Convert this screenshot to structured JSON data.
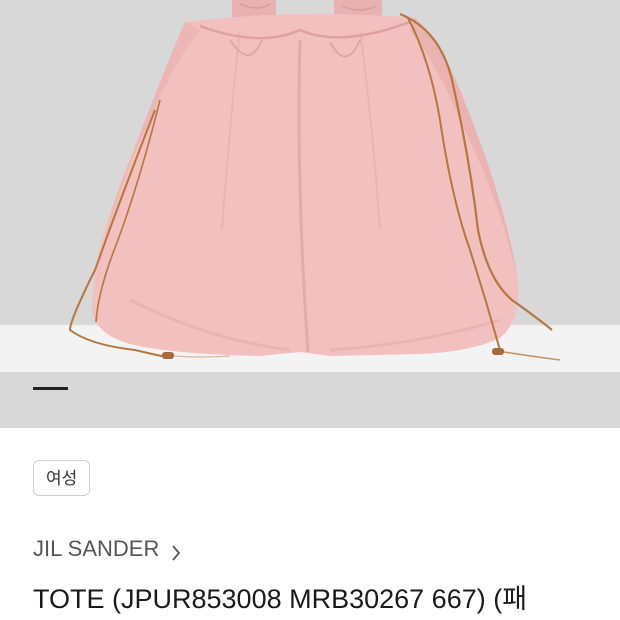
{
  "product": {
    "image_alt": "pink drawstring tote bag",
    "tag": "여성",
    "brand": "JIL SANDER",
    "title": "TOTE (JPUR853008 MRB30267 667) (패"
  },
  "icons": {
    "brand_link": "chevron-right-icon"
  },
  "colors": {
    "bag_pink": "#f2c0bf",
    "cord_brown": "#b5773f",
    "background_gray": "#d9d9d9"
  },
  "carousel": {
    "active_index": 1
  }
}
